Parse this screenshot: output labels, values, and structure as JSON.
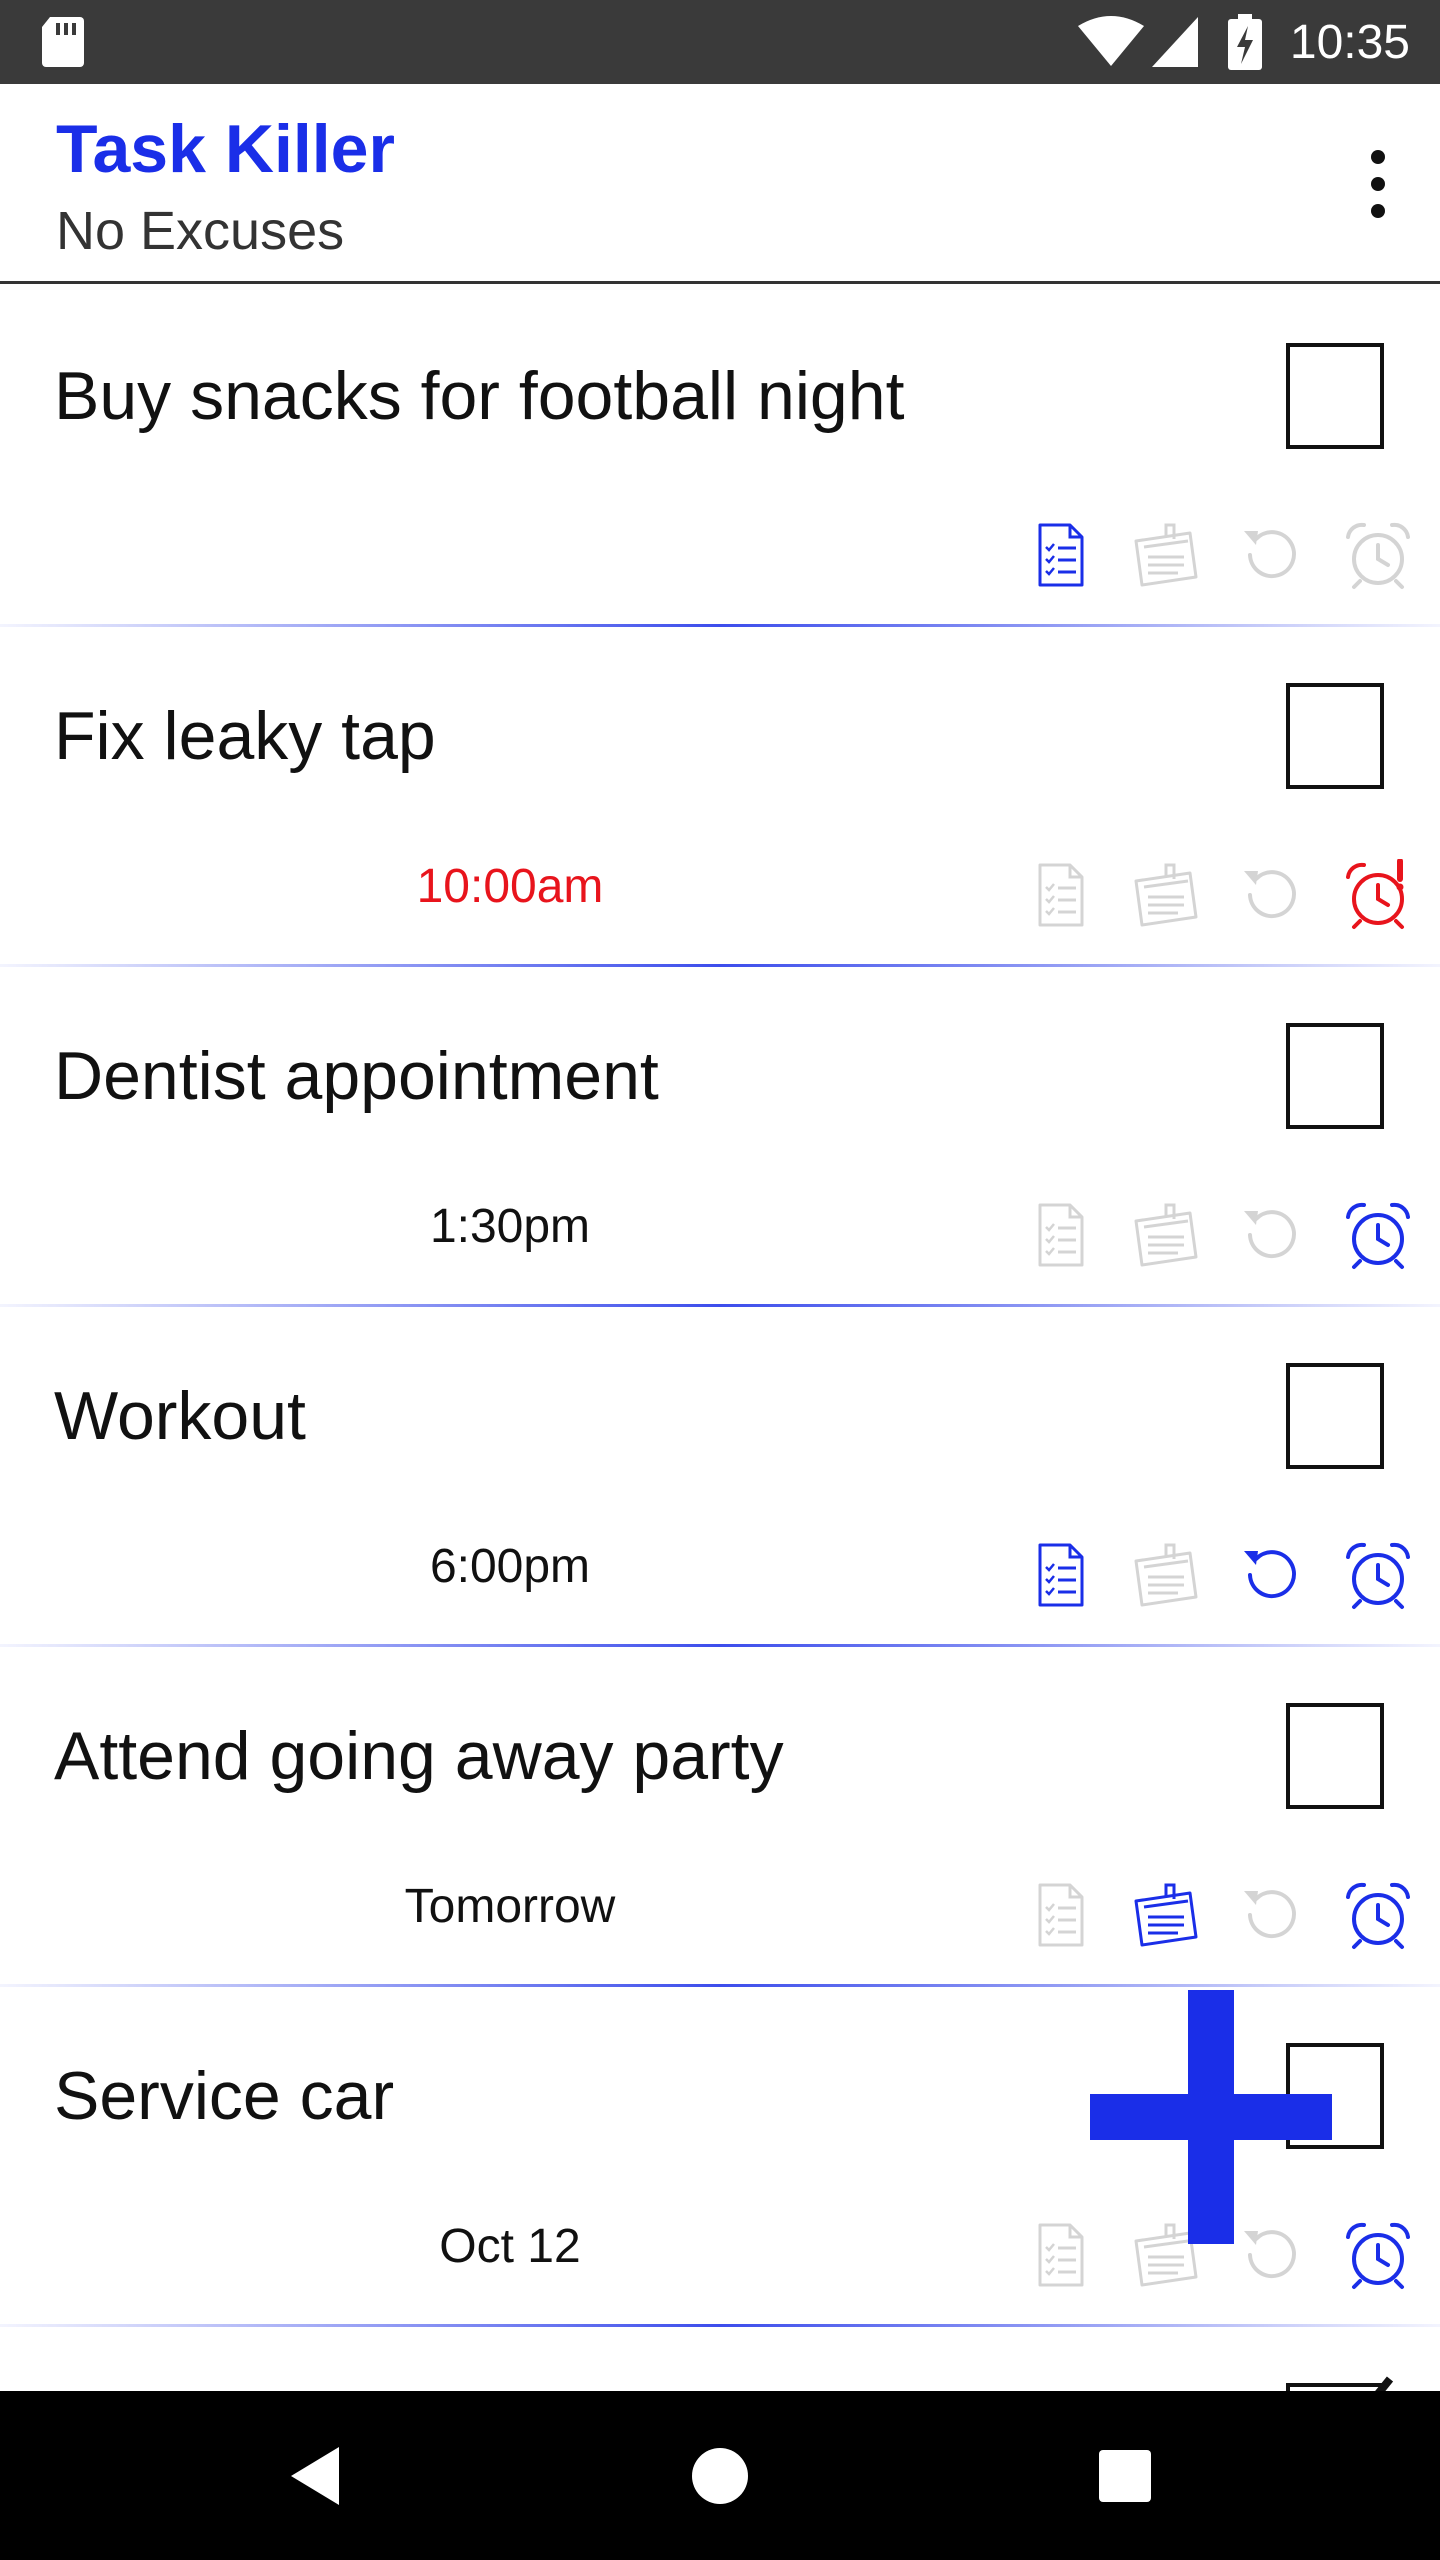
{
  "status_bar": {
    "time": "10:35",
    "icons": [
      "sd-card-icon",
      "wifi-icon",
      "signal-icon",
      "battery-charging-icon"
    ]
  },
  "app_bar": {
    "title": "Task Killer",
    "subtitle": "No Excuses",
    "menu_icon": "more-vert-icon"
  },
  "colors": {
    "accent": "#1a2ee8",
    "overdue": "#e8141c",
    "inactive_icon": "#d4d4d4",
    "status_bar": "#3a3a3a",
    "nav_bar": "#000000"
  },
  "tasks": [
    {
      "title": "Buy snacks for football night",
      "time": "",
      "overdue": false,
      "checked": false,
      "icons": {
        "checklist": true,
        "note": false,
        "repeat": false,
        "alarm": false,
        "alarm_overdue": false
      }
    },
    {
      "title": "Fix leaky tap",
      "time": "10:00am",
      "overdue": true,
      "checked": false,
      "icons": {
        "checklist": false,
        "note": false,
        "repeat": false,
        "alarm": true,
        "alarm_overdue": true
      }
    },
    {
      "title": "Dentist appointment",
      "time": "1:30pm",
      "overdue": false,
      "checked": false,
      "icons": {
        "checklist": false,
        "note": false,
        "repeat": false,
        "alarm": true,
        "alarm_overdue": false
      }
    },
    {
      "title": "Workout",
      "time": "6:00pm",
      "overdue": false,
      "checked": false,
      "icons": {
        "checklist": true,
        "note": false,
        "repeat": true,
        "alarm": true,
        "alarm_overdue": false
      }
    },
    {
      "title": "Attend going away party",
      "time": "Tomorrow",
      "overdue": false,
      "checked": false,
      "icons": {
        "checklist": false,
        "note": true,
        "repeat": false,
        "alarm": true,
        "alarm_overdue": false
      }
    },
    {
      "title": "Service car",
      "time": "Oct 12",
      "overdue": false,
      "checked": false,
      "icons": {
        "checklist": false,
        "note": false,
        "repeat": false,
        "alarm": true,
        "alarm_overdue": false
      }
    },
    {
      "title": "",
      "time": "",
      "overdue": false,
      "checked": true,
      "icons": {
        "checklist": false,
        "note": false,
        "repeat": false,
        "alarm": false,
        "alarm_overdue": false
      }
    }
  ],
  "fab": {
    "icon": "add-icon"
  },
  "nav_bar": {
    "icons": [
      "back-icon",
      "home-icon",
      "recents-icon"
    ]
  }
}
